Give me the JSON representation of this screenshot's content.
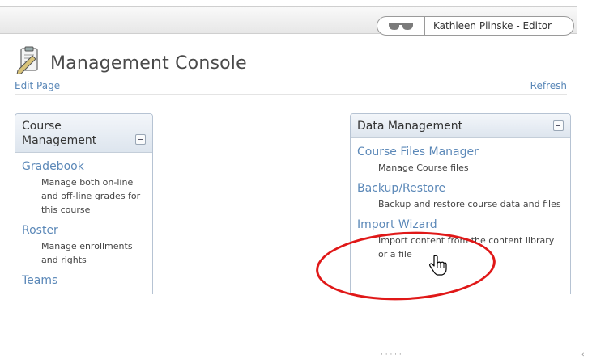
{
  "header": {
    "user_name": "Kathleen Plinske - Editor",
    "editor_icon": "glasses-icon"
  },
  "page": {
    "title": "Management Console",
    "title_icon": "clipboard-pencil-icon",
    "edit_link": "Edit Page",
    "refresh_link": "Refresh"
  },
  "course_management": {
    "title": "Course Management",
    "items": [
      {
        "label": "Gradebook",
        "desc": "Manage both on-line and off-line grades for this course"
      },
      {
        "label": "Roster",
        "desc": "Manage enrollments and rights"
      },
      {
        "label": "Teams",
        "desc": ""
      }
    ]
  },
  "data_management": {
    "title": "Data Management",
    "items": [
      {
        "label": "Course Files Manager",
        "desc": "Manage Course files"
      },
      {
        "label": "Backup/Restore",
        "desc": "Backup and restore course data and files"
      },
      {
        "label": "Import Wizard",
        "desc": "Import content from the content library or a file"
      }
    ]
  },
  "colors": {
    "link": "#5b88b8",
    "annotation": "#e01818",
    "panel_border": "#b6c3d3"
  }
}
